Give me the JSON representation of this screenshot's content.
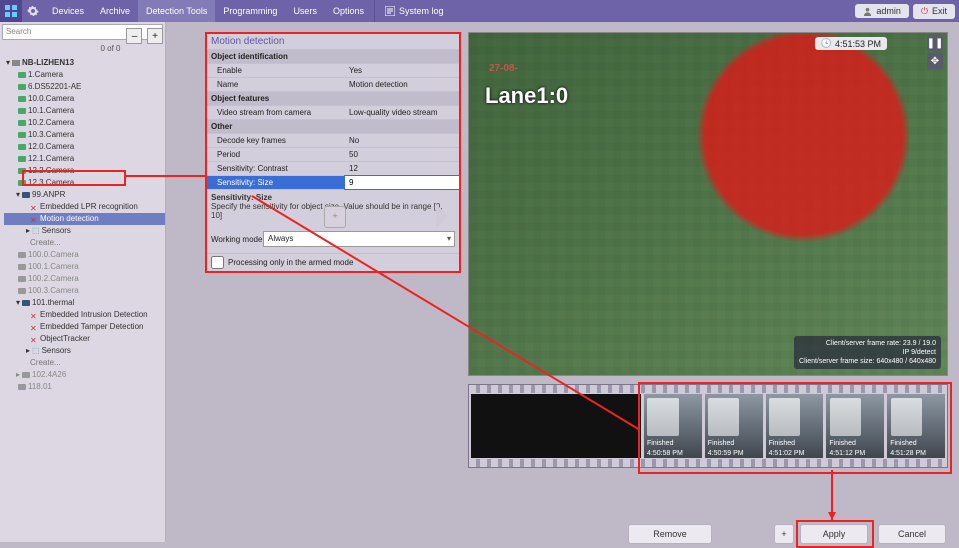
{
  "topbar": {
    "items": [
      "Devices",
      "Archive",
      "Detection Tools",
      "Programming",
      "Users",
      "Options"
    ],
    "active": 2,
    "syslog": "System log",
    "user": "admin",
    "exit": "Exit"
  },
  "sidebar": {
    "search_placeholder": "Search",
    "counter": "0 of 0",
    "root": "NB-LIZHEN13",
    "cams": [
      "1.Camera",
      "6.DS52201-AE",
      "10.0.Camera",
      "10.1.Camera",
      "10.2.Camera",
      "10.3.Camera",
      "12.0.Camera",
      "12.1.Camera",
      "12.2.Camera",
      "12.3.Camera"
    ],
    "group1": {
      "name": "99.ANPR",
      "children": [
        "Embedded LPR recognition",
        "Motion detection",
        "Sensors",
        "Create..."
      ]
    },
    "cams2": [
      "100.0.Camera",
      "100.1.Camera",
      "100.2.Camera",
      "100.3.Camera"
    ],
    "group2": {
      "name": "101.thermal",
      "children": [
        "Embedded Intrusion Detection",
        "Embedded Tamper Detection",
        "ObjectTracker",
        "Sensors",
        "Create..."
      ]
    },
    "tail": [
      "102.4A26",
      "118.01"
    ]
  },
  "props": {
    "title": "Motion detection",
    "sections": {
      "ident": {
        "label": "Object identification",
        "rows": [
          [
            "Enable",
            "Yes"
          ],
          [
            "Name",
            "Motion detection"
          ]
        ]
      },
      "feat": {
        "label": "Object features",
        "rows": [
          [
            "Video stream from camera",
            "Low-quality video stream"
          ]
        ]
      },
      "other": {
        "label": "Other",
        "rows": [
          [
            "Decode key frames",
            "No"
          ],
          [
            "Period",
            "50"
          ],
          [
            "Sensitivity: Contrast",
            "12"
          ],
          [
            "Sensitivity: Size",
            "9"
          ]
        ]
      }
    },
    "hint_title": "Sensitivity: Size",
    "hint_body": "Specify the sensitivity for object size. Value should be in range [0, 10]",
    "working_mode_label": "Working mode",
    "working_mode_value": "Always",
    "armed": "Processing only in the armed mode"
  },
  "video": {
    "lane": "Lane1:0",
    "cam_stamp": "27-08-",
    "time_chip": "4:51:53 PM",
    "info": [
      "Client/server frame rate: 23.9 / 19.0",
      "IP 9/detect",
      "Client/server frame size: 640x480 / 640x480"
    ]
  },
  "strip": {
    "thumbs": [
      {
        "label": "Finished",
        "time": "4:50:58 PM"
      },
      {
        "label": "Finished",
        "time": "4:50:59 PM"
      },
      {
        "label": "Finished",
        "time": "4:51:02 PM"
      },
      {
        "label": "Finished",
        "time": "4:51:12 PM"
      },
      {
        "label": "Finished",
        "time": "4:51:28 PM"
      }
    ]
  },
  "buttons": {
    "remove": "Remove",
    "apply": "Apply",
    "cancel": "Cancel",
    "plus": "+"
  }
}
